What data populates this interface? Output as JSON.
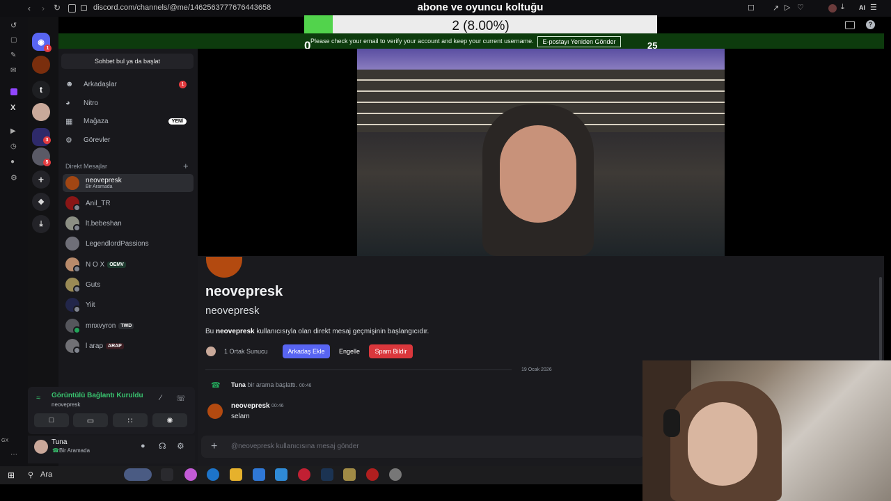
{
  "browser": {
    "url": "discord.com/channels/@me/1462563777676443658",
    "gx_label": "GX",
    "ai_label": "AI"
  },
  "overlay": {
    "title": "abone ve oyuncu koltuğu",
    "value_text": "2 (8.00%)",
    "progress_fraction": 0.08,
    "min": "0",
    "max": "25"
  },
  "verify_banner": {
    "text": "Please check your email to verify your account and keep your current username.",
    "button": "E-postayı Yeniden Gönder"
  },
  "rail": {
    "t_server": "t",
    "badges": [
      "1",
      "3",
      "5"
    ]
  },
  "sidebar": {
    "find_button": "Sohbet bul ya da başlat",
    "nav": [
      {
        "label": "Arkadaşlar",
        "icon": "friends-icon",
        "badge": "1"
      },
      {
        "label": "Nitro",
        "icon": "nitro-icon"
      },
      {
        "label": "Mağaza",
        "icon": "shop-icon",
        "badge": "YENİ"
      },
      {
        "label": "Görevler",
        "icon": "quests-icon"
      }
    ],
    "dm_header": "Direkt Mesajlar",
    "dms": [
      {
        "name": "neovepresk",
        "status": "Bir Aramada",
        "active": true
      },
      {
        "name": "Anil_TR"
      },
      {
        "name": "lt.bebeshan"
      },
      {
        "name": "LegendlordPassions"
      },
      {
        "name": "N O X",
        "tag": "OEMV"
      },
      {
        "name": "Guts"
      },
      {
        "name": "Yiit"
      },
      {
        "name": "mnxvyron",
        "tag": "TWD"
      },
      {
        "name": "l arap",
        "tag": "ARAP"
      }
    ]
  },
  "voice": {
    "status": "Görüntülü Bağlantı Kuruldu",
    "channel": "neovepresk"
  },
  "user": {
    "name": "Tuna",
    "status": "Bir Aramada"
  },
  "main": {
    "profile_name": "neovepresk",
    "profile_username": "neovepresk",
    "intro_prefix": "Bu ",
    "intro_name": "neovepresk",
    "intro_suffix": " kullanıcısıyla olan direkt mesaj geçmişinin başlangıcıdır.",
    "mutual": "1 Ortak Sunucu",
    "buttons": {
      "add_friend": "Arkadaş Ekle",
      "block": "Engelle",
      "report": "Spam Bildir"
    },
    "date": "19 Ocak 2026",
    "call_user": "Tuna",
    "call_text": " bir arama başlattı. ",
    "call_time": "00:46",
    "message": {
      "author": "neovepresk",
      "time": "00:46",
      "text": "selam"
    },
    "composer_placeholder": "@neovepresk kullanıcısına mesaj gönder"
  },
  "taskbar": {
    "search": "Ara"
  },
  "colors": {
    "blurple": "#5865f2",
    "danger": "#da373c",
    "online_green": "#23a55a",
    "banner_green": "#0d3b0d",
    "progress_green": "#52d34c"
  }
}
